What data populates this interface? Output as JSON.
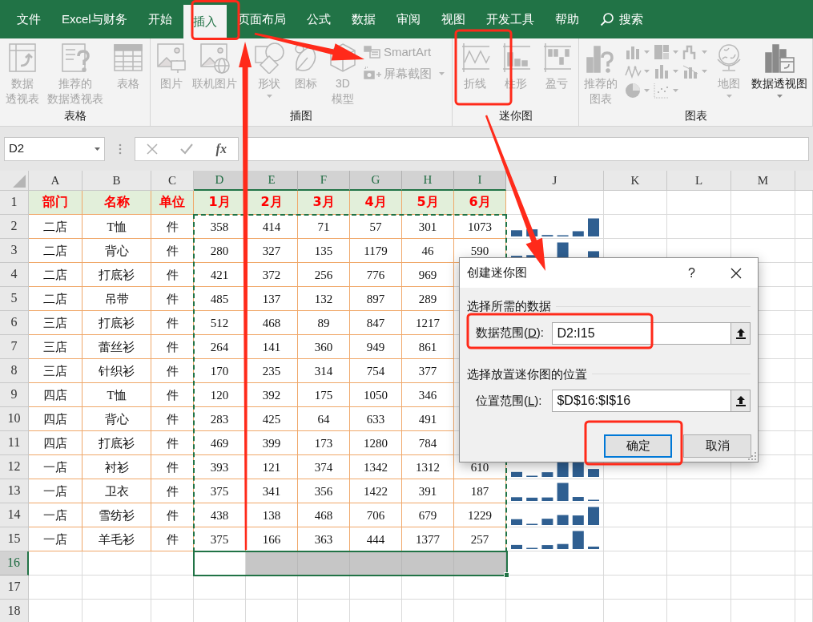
{
  "menu": {
    "tabs": [
      {
        "label": "文件",
        "selected": false
      },
      {
        "label": "Excel与财务",
        "selected": false
      },
      {
        "label": "开始",
        "selected": false
      },
      {
        "label": "插入",
        "selected": true
      },
      {
        "label": "页面布局",
        "selected": false
      },
      {
        "label": "公式",
        "selected": false
      },
      {
        "label": "数据",
        "selected": false
      },
      {
        "label": "审阅",
        "selected": false
      },
      {
        "label": "视图",
        "selected": false
      },
      {
        "label": "开发工具",
        "selected": false
      },
      {
        "label": "帮助",
        "selected": false
      }
    ],
    "search": "搜索"
  },
  "ribbon": {
    "groups": [
      {
        "label": "表格",
        "items": [
          {
            "kind": "large",
            "label_lines": [
              "数据",
              "透视表"
            ],
            "disabled": true,
            "dropdown": false
          },
          {
            "kind": "large",
            "label_lines": [
              "推荐的",
              "数据透视表"
            ],
            "disabled": true,
            "dropdown": false
          },
          {
            "kind": "large",
            "label_lines": [
              "表格"
            ],
            "disabled": true,
            "dropdown": false
          }
        ]
      },
      {
        "label": "插图",
        "items": [
          {
            "kind": "large",
            "label_lines": [
              "图片"
            ],
            "disabled": true,
            "dropdown": false
          },
          {
            "kind": "large",
            "label_lines": [
              "联机图片"
            ],
            "disabled": true,
            "dropdown": false
          },
          {
            "kind": "large",
            "label_lines": [
              "形状"
            ],
            "disabled": true,
            "dropdown": true
          },
          {
            "kind": "large",
            "label_lines": [
              "图标"
            ],
            "disabled": true,
            "dropdown": false
          },
          {
            "kind": "large",
            "label_lines": [
              "3D",
              "模型"
            ],
            "disabled": true,
            "dropdown": false
          },
          {
            "kind": "small",
            "label": "SmartArt",
            "disabled": true,
            "dropdown": false
          },
          {
            "kind": "small",
            "label": "屏幕截图",
            "disabled": true,
            "dropdown": true
          }
        ]
      },
      {
        "label": "迷你图",
        "items": [
          {
            "kind": "large",
            "label_lines": [
              "折线"
            ],
            "disabled": true,
            "dropdown": false
          },
          {
            "kind": "large",
            "label_lines": [
              "柱形"
            ],
            "disabled": true,
            "dropdown": false
          },
          {
            "kind": "large",
            "label_lines": [
              "盈亏"
            ],
            "disabled": true,
            "dropdown": false
          }
        ]
      },
      {
        "label": "图表",
        "items": [
          {
            "kind": "large",
            "label_lines": [
              "推荐的",
              "图表"
            ],
            "disabled": true,
            "dropdown": false
          },
          {
            "kind": "gallery",
            "disabled": true
          },
          {
            "kind": "large",
            "label_lines": [
              "地图"
            ],
            "disabled": true,
            "dropdown": true
          },
          {
            "kind": "large",
            "label_lines": [
              "数据透视图"
            ],
            "disabled": false,
            "dropdown": true
          }
        ]
      }
    ]
  },
  "formula_bar": {
    "name_box": "D2",
    "function_label": "fx"
  },
  "sheet": {
    "columns": [
      {
        "label": "A",
        "selected": false
      },
      {
        "label": "B",
        "selected": false
      },
      {
        "label": "C",
        "selected": false
      },
      {
        "label": "D",
        "selected": true
      },
      {
        "label": "E",
        "selected": true
      },
      {
        "label": "F",
        "selected": true
      },
      {
        "label": "G",
        "selected": true
      },
      {
        "label": "H",
        "selected": true
      },
      {
        "label": "I",
        "selected": true
      },
      {
        "label": "J",
        "selected": false
      },
      {
        "label": "K",
        "selected": false
      },
      {
        "label": "L",
        "selected": false
      },
      {
        "label": "M",
        "selected": false
      }
    ],
    "rows": [
      {
        "number": "1",
        "kind": "header",
        "selected": false,
        "sparkline": false,
        "cells": [
          "部门",
          "名称",
          "单位",
          "1月",
          "2月",
          "3月",
          "4月",
          "5月",
          "6月"
        ]
      },
      {
        "number": "2",
        "kind": "data",
        "selected": false,
        "sparkline": true,
        "cells": [
          "二店",
          "T恤",
          "件",
          "358",
          "414",
          "71",
          "57",
          "301",
          "1073"
        ]
      },
      {
        "number": "3",
        "kind": "data",
        "selected": false,
        "sparkline": true,
        "cells": [
          "二店",
          "背心",
          "件",
          "280",
          "327",
          "135",
          "1179",
          "46",
          "590"
        ]
      },
      {
        "number": "4",
        "kind": "data",
        "selected": false,
        "cells": [
          "二店",
          "打底衫",
          "件",
          "421",
          "372",
          "256",
          "776",
          "969",
          null
        ]
      },
      {
        "number": "5",
        "kind": "data",
        "selected": false,
        "cells": [
          "二店",
          "吊带",
          "件",
          "485",
          "137",
          "132",
          "897",
          "289",
          null
        ]
      },
      {
        "number": "6",
        "kind": "data",
        "selected": false,
        "cells": [
          "三店",
          "打底衫",
          "件",
          "512",
          "468",
          "89",
          "847",
          "1217",
          null
        ]
      },
      {
        "number": "7",
        "kind": "data",
        "selected": false,
        "cells": [
          "三店",
          "蕾丝衫",
          "件",
          "264",
          "141",
          "360",
          "949",
          "861",
          null
        ]
      },
      {
        "number": "8",
        "kind": "data",
        "selected": false,
        "cells": [
          "三店",
          "针织衫",
          "件",
          "170",
          "235",
          "314",
          "754",
          "377",
          null
        ]
      },
      {
        "number": "9",
        "kind": "data",
        "selected": false,
        "cells": [
          "四店",
          "T恤",
          "件",
          "120",
          "392",
          "175",
          "1050",
          "346",
          null
        ]
      },
      {
        "number": "10",
        "kind": "data",
        "selected": false,
        "cells": [
          "四店",
          "背心",
          "件",
          "283",
          "425",
          "64",
          "633",
          "491",
          null
        ]
      },
      {
        "number": "11",
        "kind": "data",
        "selected": false,
        "cells": [
          "四店",
          "打底衫",
          "件",
          "469",
          "399",
          "173",
          "1280",
          "784",
          null
        ]
      },
      {
        "number": "12",
        "kind": "data",
        "selected": false,
        "sparkline": true,
        "cells": [
          "一店",
          "衬衫",
          "件",
          "393",
          "121",
          "374",
          "1342",
          "1312",
          "610"
        ]
      },
      {
        "number": "13",
        "kind": "data",
        "selected": false,
        "sparkline": true,
        "cells": [
          "一店",
          "卫衣",
          "件",
          "375",
          "341",
          "356",
          "1422",
          "391",
          "187"
        ]
      },
      {
        "number": "14",
        "kind": "data",
        "selected": false,
        "sparkline": true,
        "cells": [
          "一店",
          "雪纺衫",
          "件",
          "438",
          "138",
          "468",
          "706",
          "679",
          "1229"
        ]
      },
      {
        "number": "15",
        "kind": "data",
        "selected": false,
        "sparkline": true,
        "cells": [
          "一店",
          "羊毛衫",
          "件",
          "375",
          "166",
          "363",
          "444",
          "1377",
          "257"
        ]
      },
      {
        "number": "16",
        "kind": "empty",
        "selected": true,
        "sparkline": false,
        "cells": []
      },
      {
        "number": "17",
        "kind": "empty",
        "selected": false,
        "sparkline": false,
        "cells": []
      },
      {
        "number": "18",
        "kind": "empty",
        "selected": false,
        "sparkline": false,
        "cells": []
      }
    ]
  },
  "dialog": {
    "title": "创建迷你图",
    "help": "?",
    "sections": [
      {
        "heading": "选择所需的数据",
        "label_start": "数据范围(",
        "access_key": "D",
        "label_end": "):",
        "value": "D2:I15"
      },
      {
        "heading": "选择放置迷你图的位置",
        "label_start": "位置范围(",
        "access_key": "L",
        "label_end": "):",
        "value": "$D$16:$I$16"
      }
    ],
    "buttons": [
      {
        "label": "确定",
        "default": true
      },
      {
        "label": "取消",
        "default": false
      }
    ]
  }
}
